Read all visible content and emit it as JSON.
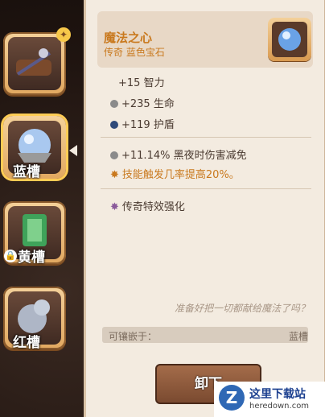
{
  "slots": [
    {
      "label": "",
      "icon": "instrument-icon"
    },
    {
      "label": "蓝槽",
      "icon": "blue-orb-icon"
    },
    {
      "label": "黄槽",
      "icon": "green-gem-icon",
      "locked": true
    },
    {
      "label": "红槽",
      "icon": "silver-orb-icon"
    }
  ],
  "detail": {
    "title": "魔法之心",
    "subtitle": "传奇 蓝色宝石",
    "stats": [
      {
        "text": "+15 智力"
      },
      {
        "text": "+235 生命"
      },
      {
        "text": "+119 护盾"
      }
    ],
    "special": [
      {
        "text": "+11.14% 黑夜时伤害减免"
      },
      {
        "text": "技能触发几率提高20%。"
      }
    ],
    "legendary": "传奇特效强化",
    "quote": "准备好把一切都献给魔法了吗？",
    "socket_label": "可镶嵌于：",
    "socket_value": "蓝槽",
    "unload_label": "卸下"
  },
  "watermark": {
    "name": "这里下载站",
    "url": "heredown.com"
  }
}
